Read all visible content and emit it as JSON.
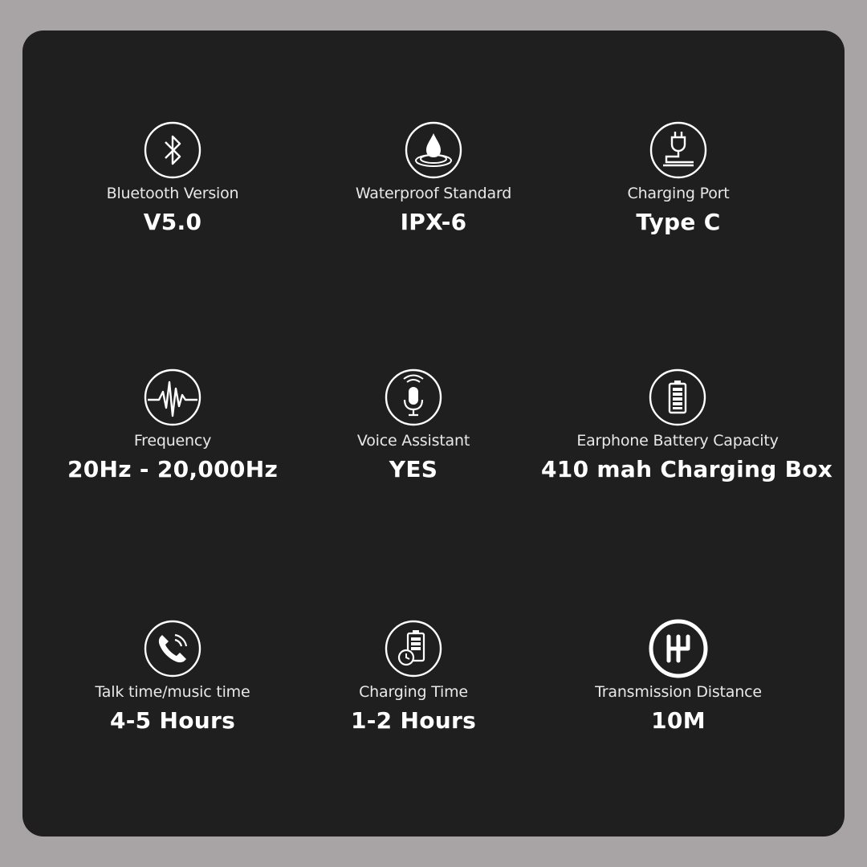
{
  "specs": [
    {
      "icon": "bluetooth-icon",
      "label": "Bluetooth Version",
      "value": "V5.0"
    },
    {
      "icon": "water-drop-icon",
      "label": "Waterproof Standard",
      "value": "IPX-6"
    },
    {
      "icon": "charging-plug-icon",
      "label": "Charging Port",
      "value": "Type C"
    },
    {
      "icon": "frequency-wave-icon",
      "label": "Frequency",
      "value": "20Hz - 20,000Hz"
    },
    {
      "icon": "microphone-icon",
      "label": "Voice Assistant",
      "value": "YES"
    },
    {
      "icon": "battery-icon",
      "label": "Earphone Battery Capacity",
      "value": "410 mah Charging Box"
    },
    {
      "icon": "phone-call-icon",
      "label": "Talk time/music time",
      "value": "4-5 Hours"
    },
    {
      "icon": "battery-clock-icon",
      "label": "Charging Time",
      "value": "1-2 Hours"
    },
    {
      "icon": "gear-shift-icon",
      "label": "Transmission Distance",
      "value": "10M"
    }
  ],
  "colors": {
    "background": "#a8a4a5",
    "panel": "#1f1f1f",
    "text": "#ffffff"
  }
}
